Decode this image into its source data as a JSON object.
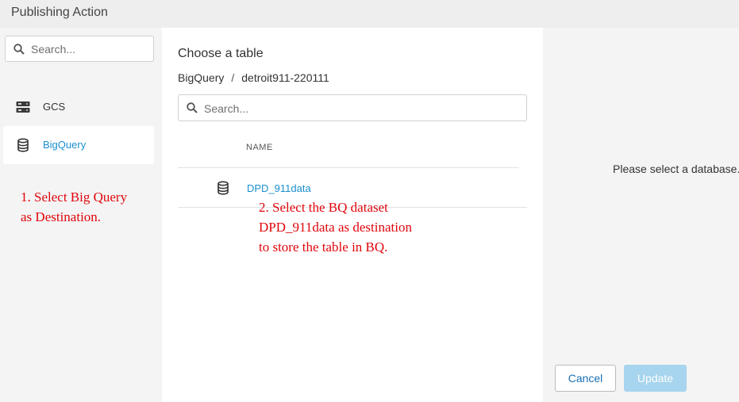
{
  "window": {
    "title": "Publishing Action"
  },
  "sidebar": {
    "search_placeholder": "Search...",
    "items": [
      {
        "label": "GCS",
        "icon": "storage-icon",
        "active": false
      },
      {
        "label": "BigQuery",
        "icon": "database-icon",
        "active": true
      }
    ]
  },
  "annotations": {
    "step1": "1. Select Big Query\nas Destination.",
    "step2": "2. Select the BQ dataset\nDPD_911data as destination\nto store the table in BQ.",
    "color": "#e0060c"
  },
  "main": {
    "heading": "Choose a table",
    "breadcrumb": {
      "root": "BigQuery",
      "separator": "/",
      "current": "detroit911-220111"
    },
    "search_placeholder": "Search...",
    "table": {
      "column_header": "NAME",
      "rows": [
        {
          "name": "DPD_911data",
          "icon": "database-icon"
        }
      ]
    }
  },
  "details": {
    "empty_message": "Please select a database.",
    "cancel_label": "Cancel",
    "update_label": "Update"
  },
  "colors": {
    "accent": "#1a8fcf",
    "update_disabled_bg": "#a7d4ee",
    "panel_bg": "#f4f4f4",
    "titlebar_bg": "#eeeeee"
  }
}
